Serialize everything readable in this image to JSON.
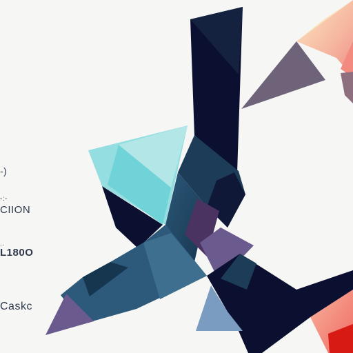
{
  "text_fragments": [
    "-)",
    "-:-",
    "CIION",
    "..",
    "L180O",
    "Caskc"
  ],
  "colors": {
    "background": "#f6f6f5",
    "navy": "#0b1030",
    "dark_teal": "#1f4a66",
    "teal": "#3f6f8e",
    "light_cyan": "#94dde0",
    "aqua": "#6fd3d8",
    "purple": "#6b5a8e",
    "mauve": "#6e6378",
    "peach": "#f7c9a8",
    "salmon": "#f28a80",
    "red": "#d81a14"
  }
}
